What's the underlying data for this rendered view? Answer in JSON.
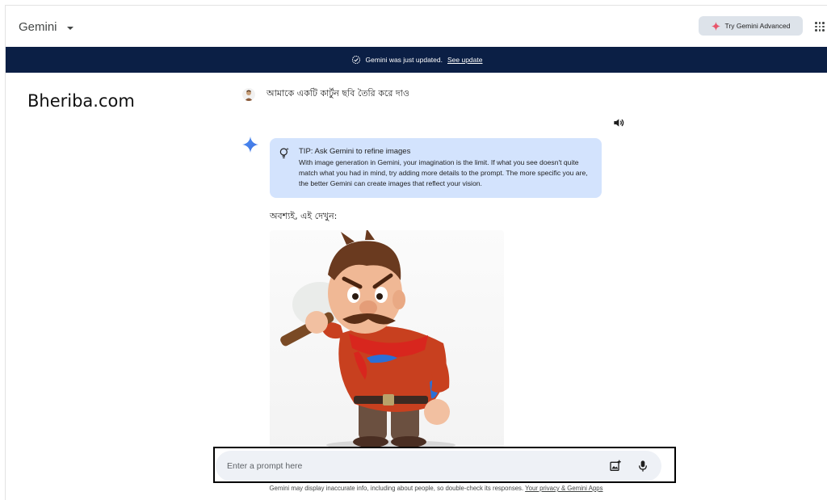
{
  "header": {
    "app_title": "Gemini",
    "try_advanced_label": "Try Gemini Advanced"
  },
  "banner": {
    "message": "Gemini was just updated.",
    "link_label": "See update"
  },
  "watermark": "Bheriba.com",
  "conversation": {
    "user_prompt": "আমাকে একটি কার্টুন ছবি তৈরি করে দাও",
    "tip_title": "TIP: Ask Gemini to refine images",
    "tip_body": "With image generation in Gemini, your imagination is the limit. If what you see doesn't quite match what you had in mind, try adding more details to the prompt. The more specific you are, the better Gemini can create images that reflect your vision.",
    "answer_text": "অবশ্যই, এই দেখুন:"
  },
  "input": {
    "placeholder": "Enter a prompt here"
  },
  "footer": {
    "disclaimer": "Gemini may display inaccurate info, including about people, so double-check its responses.",
    "link_label": "Your privacy & Gemini Apps"
  },
  "colors": {
    "banner_bg": "#0b1f45",
    "tip_bg": "#d3e3fd",
    "input_bg": "#eef1f6",
    "spark_blue": "#4b8ef2",
    "spark_pink": "#e8556b"
  }
}
